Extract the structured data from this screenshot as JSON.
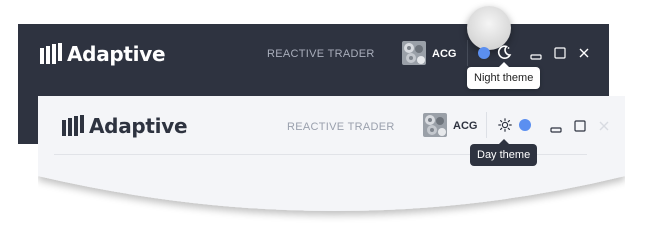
{
  "night_header": {
    "logo_text": "Adaptive",
    "app_title": "REACTIVE TRADER",
    "user": "ACG",
    "tooltip": "Night theme",
    "colors": {
      "background": "#2e3340",
      "text": "#ffffff",
      "accent": "#5b8ff0"
    },
    "icons": [
      "adaptive-logo-icon",
      "avatar",
      "theme-dot-icon",
      "moon-icon",
      "minimize-icon",
      "maximize-icon",
      "close-icon"
    ]
  },
  "day_header": {
    "logo_text": "Adaptive",
    "app_title": "REACTIVE TRADER",
    "user": "ACG",
    "tooltip": "Day theme",
    "colors": {
      "background": "#f4f5f8",
      "text": "#2e3340",
      "accent": "#5b8ff0"
    },
    "icons": [
      "adaptive-logo-icon",
      "avatar",
      "sun-icon",
      "theme-dot-icon",
      "minimize-icon",
      "maximize-icon",
      "close-icon"
    ]
  }
}
